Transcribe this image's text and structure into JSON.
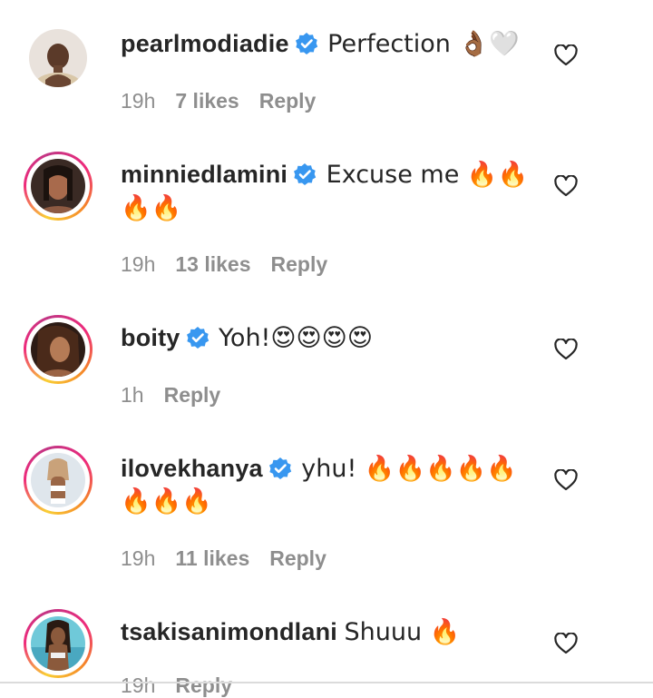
{
  "colors": {
    "verified": "#3897f0",
    "muted": "#8e8e8e",
    "text": "#262626"
  },
  "comments": [
    {
      "username": "pearlmodiadie",
      "verified": true,
      "text": "Perfection 👌🏾🤍",
      "line2": "",
      "time": "19h",
      "likes": "7 likes",
      "reply": "Reply",
      "avatar_icon": "avatar-photo",
      "story_ring": false
    },
    {
      "username": "minniedlamini",
      "verified": true,
      "text": "Excuse me 🔥🔥",
      "line2": "🔥🔥",
      "time": "19h",
      "likes": "13 likes",
      "reply": "Reply",
      "avatar_icon": "avatar-photo",
      "story_ring": true
    },
    {
      "username": "boity",
      "verified": true,
      "text": "Yoh!😍😍😍😍",
      "line2": "",
      "time": "1h",
      "likes": "",
      "reply": "Reply",
      "avatar_icon": "avatar-photo",
      "story_ring": true
    },
    {
      "username": "ilovekhanya",
      "verified": true,
      "text": "yhu! 🔥🔥🔥🔥🔥",
      "line2": "🔥🔥🔥",
      "time": "19h",
      "likes": "11 likes",
      "reply": "Reply",
      "avatar_icon": "avatar-photo",
      "story_ring": true
    },
    {
      "username": "tsakisanimondlani",
      "verified": false,
      "text": "Shuuu 🔥",
      "line2": "",
      "time": "19h",
      "likes": "",
      "reply": "Reply",
      "avatar_icon": "avatar-photo",
      "story_ring": true
    }
  ]
}
